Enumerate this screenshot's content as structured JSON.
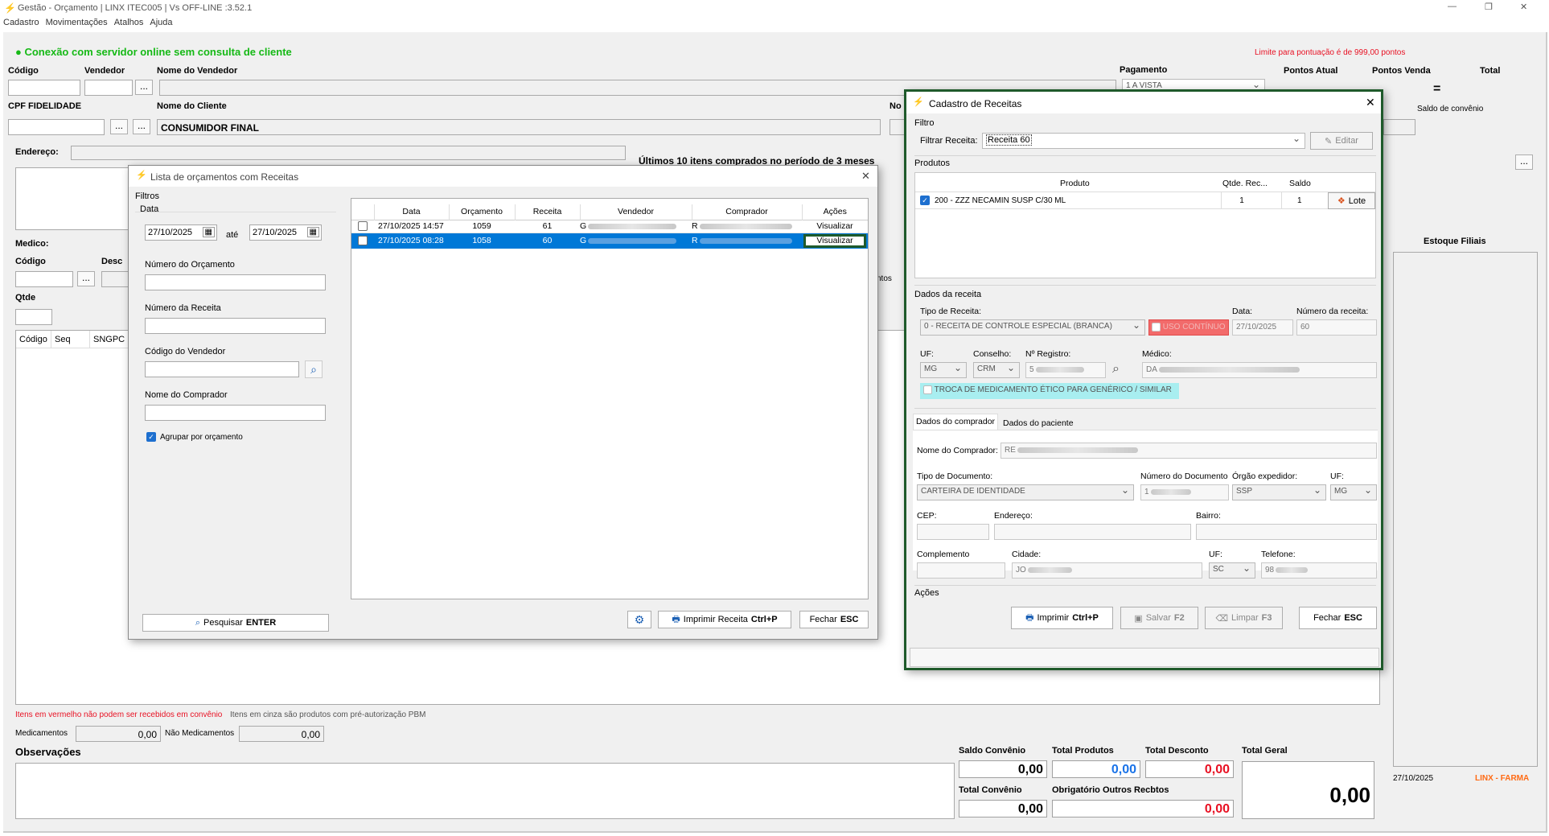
{
  "window": {
    "title": "Gestão - Orçamento  | LINX ITEC005 | Vs OFF-LINE :3.52.1",
    "min": "—",
    "max": "❐",
    "close": "✕"
  },
  "menu": [
    "Cadastro",
    "Movimentações",
    "Atalhos",
    "Ajuda"
  ],
  "status": {
    "connection": "Conexão com servidor online sem consulta de cliente",
    "limit": "Limite para pontuação é de 999,00 pontos"
  },
  "main": {
    "codigo": "Código",
    "vendedor": "Vendedor",
    "nome_vendedor": "Nome do Vendedor",
    "pagamento": "Pagamento",
    "pagamento_val": "1 A VISTA",
    "pontos_atual": "Pontos Atual",
    "pontos_venda": "Pontos Venda",
    "total": "Total",
    "equals": "=",
    "saldo_convenio_lbl": "Saldo de convênio",
    "cpf": "CPF FIDELIDADE",
    "nome_cliente": "Nome do Cliente",
    "cliente_val": "CONSUMIDOR FINAL",
    "no": "No",
    "endereco": "Endereço:",
    "ultimos": "Últimos 10 itens comprados no período de 3 meses",
    "medico": "Medico:",
    "codigo2": "Código",
    "desc": "Desc",
    "qtde": "Qtde",
    "col_codigo": "Código",
    "col_seq": "Seq",
    "col_sngpc": "SNGPC",
    "ntos": "ntos",
    "estoque": "Estoque Filiais",
    "dots": "...",
    "red_note": "Itens em vermelho não podem ser recebidos em convênio",
    "gray_note": "Itens em cinza são produtos com pré-autorização PBM",
    "medicamentos": "Medicamentos",
    "medicamentos_val": "0,00",
    "nao_med": "Não Medicamentos",
    "nao_med_val": "0,00",
    "observacoes": "Observações",
    "saldo_conv": "Saldo Convênio",
    "saldo_conv_val": "0,00",
    "total_prod": "Total Produtos",
    "total_prod_val": "0,00",
    "total_desc": "Total Desconto",
    "total_desc_val": "0,00",
    "total_geral": "Total Geral",
    "total_geral_val": "0,00",
    "total_conv": "Total Convênio",
    "total_conv_val": "0,00",
    "obrig": "Obrigatório Outros Recbtos",
    "obrig_val": "0,00",
    "date": "27/10/2025",
    "brand": "LINX - FARMA"
  },
  "lista": {
    "title": "Lista de orçamentos com Receitas",
    "close": "✕",
    "filtros": "Filtros",
    "data": "Data",
    "date_from": "27/10/2025",
    "ate": "até",
    "date_to": "27/10/2025",
    "num_orc": "Número do Orçamento",
    "num_rec": "Número da Receita",
    "cod_vend": "Código do Vendedor",
    "nome_comp": "Nome do Comprador",
    "agrupar": "Agrupar por orçamento",
    "pesquisar": "Pesquisar",
    "pesquisar_key": "ENTER",
    "cols": [
      "Data",
      "Orçamento",
      "Receita",
      "Vendedor",
      "Comprador",
      "Ações"
    ],
    "rows": [
      {
        "data": "27/10/2025 14:57",
        "orc": "1059",
        "rec": "61",
        "vend": "G",
        "comp": "R",
        "acao": "Visualizar"
      },
      {
        "data": "27/10/2025 08:28",
        "orc": "1058",
        "rec": "60",
        "vend": "G",
        "comp": "R",
        "acao": "Visualizar"
      }
    ],
    "imprimir": "Imprimir Receita",
    "imprimir_key": "Ctrl+P",
    "fechar": "Fechar",
    "fechar_key": "ESC"
  },
  "cad": {
    "title": "Cadastro de Receitas",
    "close": "✕",
    "filtro": "Filtro",
    "filtrar": "Filtrar Receita:",
    "filtrar_val": "Receita 60",
    "editar": "Editar",
    "produtos": "Produtos",
    "col_produto": "Produto",
    "col_qtde": "Qtde. Rec...",
    "col_saldo": "Saldo",
    "prod_nome": "200 - ZZZ NECAMIN SUSP C/30 ML",
    "prod_qtde": "1",
    "prod_saldo": "1",
    "lote": "Lote",
    "dados_receita": "Dados da receita",
    "tipo": "Tipo de Receita:",
    "tipo_val": "0 - RECEITA DE CONTROLE ESPECIAL (BRANCA)",
    "uso": "USO CONTÍNUO",
    "data": "Data:",
    "data_val": "27/10/2025",
    "num_rec": "Número da receita:",
    "num_rec_val": "60",
    "uf": "UF:",
    "uf_val": "MG",
    "conselho": "Conselho:",
    "conselho_val": "CRM",
    "registro": "Nº Registro:",
    "registro_val": "5",
    "medico": "Médico:",
    "medico_val": "DA",
    "troca": "TROCA DE MEDICAMENTO ÉTICO PARA GENÉRICO / SIMILAR",
    "tab1": "Dados do comprador",
    "tab2": "Dados do paciente",
    "nome_comp": "Nome do Comprador:",
    "nome_comp_val": "RE",
    "tipo_doc": "Tipo de Documento:",
    "tipo_doc_val": "CARTEIRA DE IDENTIDADE",
    "num_doc": "Número do Documento",
    "num_doc_val": "1",
    "orgao": "Órgão expedidor:",
    "orgao_val": "SSP",
    "uf2": "UF:",
    "uf2_val": "MG",
    "cep": "CEP:",
    "endereco": "Endereço:",
    "bairro": "Bairro:",
    "complemento": "Complemento",
    "cidade": "Cidade:",
    "cidade_val": "JO",
    "uf3": "UF:",
    "uf3_val": "SC",
    "telefone": "Telefone:",
    "telefone_val": "98",
    "acoes": "Ações",
    "imprimir": "Imprimir",
    "imprimir_key": "Ctrl+P",
    "salvar": "Salvar",
    "salvar_key": "F2",
    "limpar": "Limpar",
    "limpar_key": "F3",
    "fechar": "Fechar",
    "fechar_key": "ESC"
  },
  "colors": {
    "accent": "#1a73e8",
    "highlight": "#0078d7",
    "green_border": "#1f5a2b",
    "red": "#e81123",
    "uso_bg": "#f26b6b",
    "troca_bg": "#a8eef0"
  }
}
